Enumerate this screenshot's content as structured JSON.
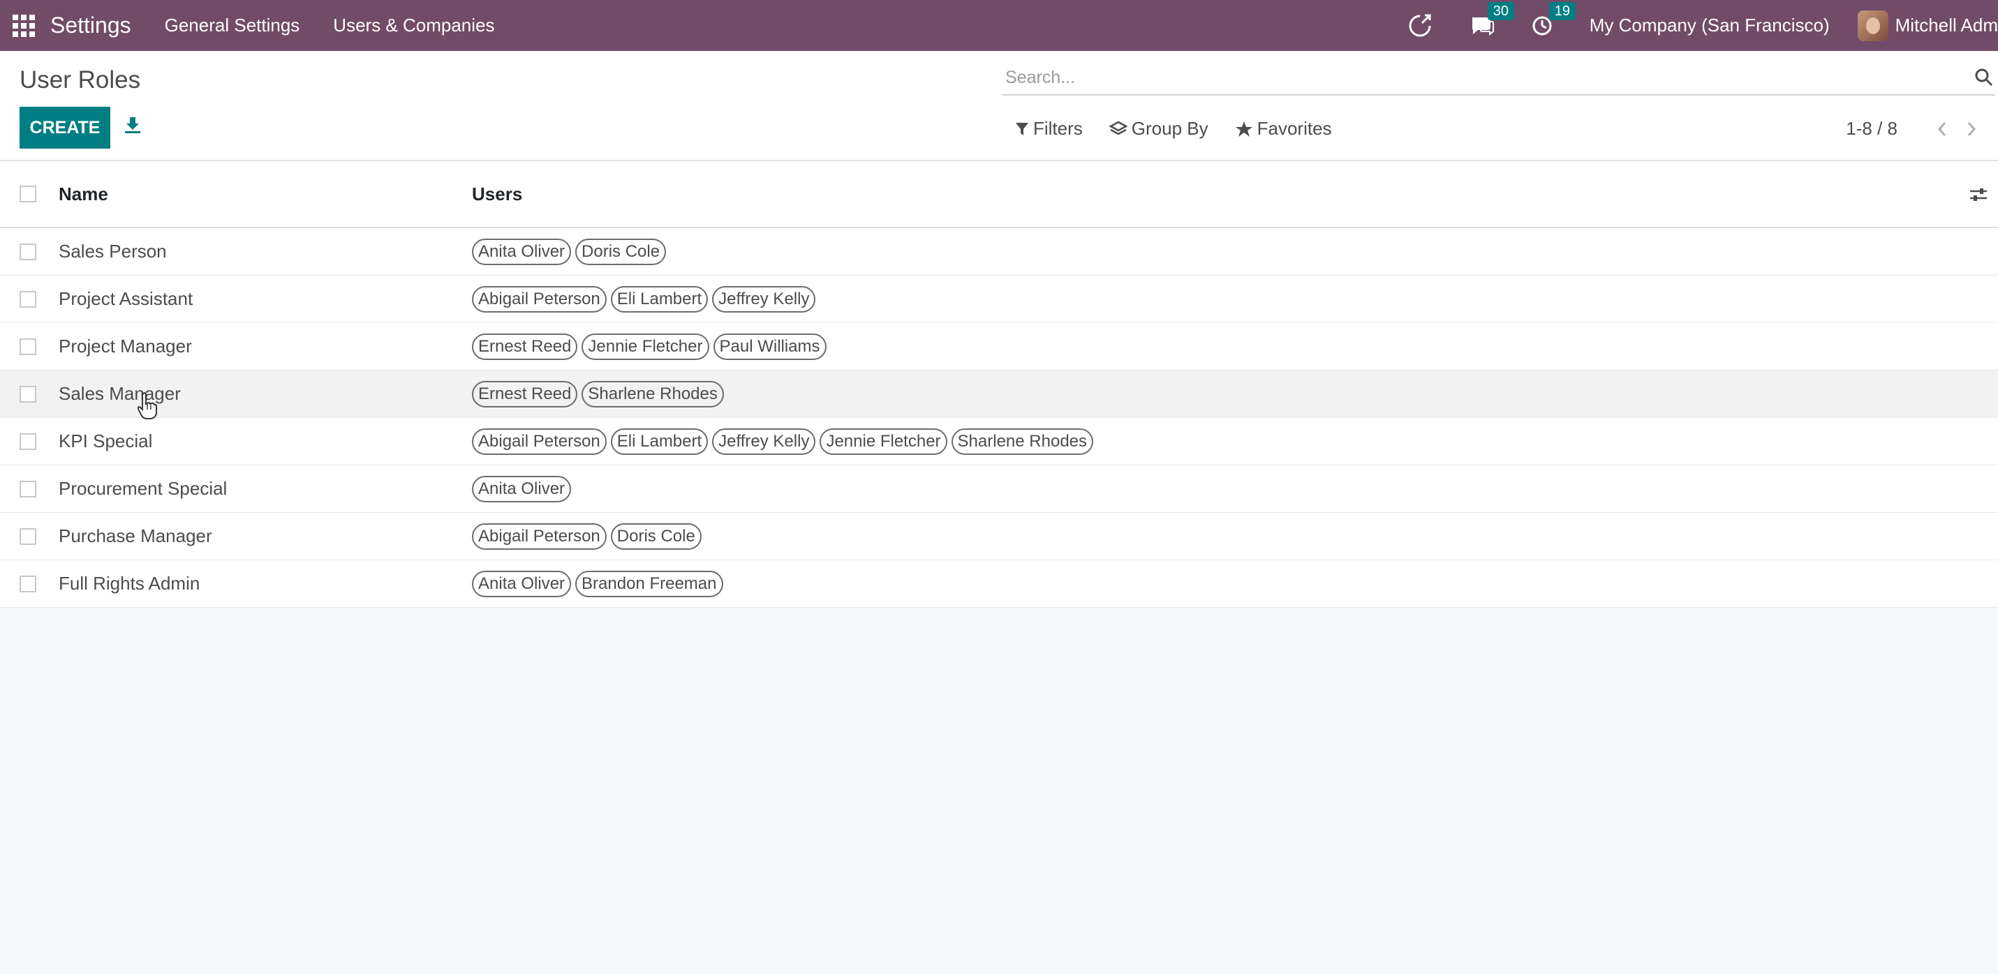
{
  "navbar": {
    "brand": "Settings",
    "menu": [
      "General Settings",
      "Users & Companies"
    ],
    "messages_count": "30",
    "activities_count": "19",
    "company": "My Company (San Francisco)",
    "user": "Mitchell Adm"
  },
  "control_panel": {
    "title": "User Roles",
    "create_label": "CREATE",
    "search_placeholder": "Search...",
    "filters_label": "Filters",
    "group_by_label": "Group By",
    "favorites_label": "Favorites",
    "pager": "1-8 / 8"
  },
  "table": {
    "headers": {
      "name": "Name",
      "users": "Users"
    },
    "rows": [
      {
        "name": "Sales Person",
        "users": [
          "Anita Oliver",
          "Doris Cole"
        ]
      },
      {
        "name": "Project Assistant",
        "users": [
          "Abigail Peterson",
          "Eli Lambert",
          "Jeffrey Kelly"
        ]
      },
      {
        "name": "Project Manager",
        "users": [
          "Ernest Reed",
          "Jennie Fletcher",
          "Paul Williams"
        ]
      },
      {
        "name": "Sales Manager",
        "users": [
          "Ernest Reed",
          "Sharlene Rhodes"
        ]
      },
      {
        "name": "KPI Special",
        "users": [
          "Abigail Peterson",
          "Eli Lambert",
          "Jeffrey Kelly",
          "Jennie Fletcher",
          "Sharlene Rhodes"
        ]
      },
      {
        "name": "Procurement Special",
        "users": [
          "Anita Oliver"
        ]
      },
      {
        "name": "Purchase Manager",
        "users": [
          "Abigail Peterson",
          "Doris Cole"
        ]
      },
      {
        "name": "Full Rights Admin",
        "users": [
          "Anita Oliver",
          "Brandon Freeman"
        ]
      }
    ]
  },
  "colors": {
    "navbar": "#714b67",
    "primary": "#017e84"
  }
}
